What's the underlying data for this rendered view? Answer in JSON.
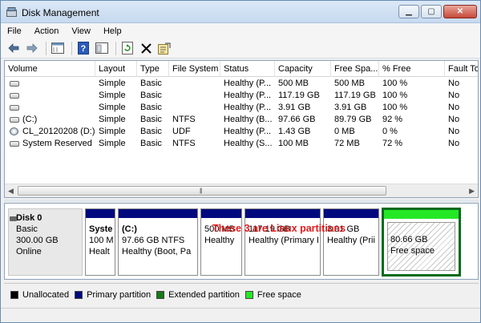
{
  "window": {
    "title": "Disk Management"
  },
  "menu": [
    "File",
    "Action",
    "View",
    "Help"
  ],
  "toolbar": {
    "icons": [
      "back-arrow-icon",
      "forward-arrow-icon",
      "properties-icon",
      "help-icon",
      "show-hide-icon",
      "refresh-icon",
      "delete-icon",
      "properties-wizard-icon"
    ]
  },
  "columns": [
    "Volume",
    "Layout",
    "Type",
    "File System",
    "Status",
    "Capacity",
    "Free Spa...",
    "% Free",
    "Fault To"
  ],
  "volumes": [
    {
      "icon": "drive-icon",
      "name": "",
      "layout": "Simple",
      "type": "Basic",
      "fs": "",
      "status": "Healthy (P...",
      "capacity": "500 MB",
      "free": "500 MB",
      "pct": "100 %",
      "fault": "No"
    },
    {
      "icon": "drive-icon",
      "name": "",
      "layout": "Simple",
      "type": "Basic",
      "fs": "",
      "status": "Healthy (P...",
      "capacity": "117.19 GB",
      "free": "117.19 GB",
      "pct": "100 %",
      "fault": "No"
    },
    {
      "icon": "drive-icon",
      "name": "",
      "layout": "Simple",
      "type": "Basic",
      "fs": "",
      "status": "Healthy (P...",
      "capacity": "3.91 GB",
      "free": "3.91 GB",
      "pct": "100 %",
      "fault": "No"
    },
    {
      "icon": "drive-icon",
      "name": "(C:)",
      "layout": "Simple",
      "type": "Basic",
      "fs": "NTFS",
      "status": "Healthy (B...",
      "capacity": "97.66 GB",
      "free": "89.79 GB",
      "pct": "92 %",
      "fault": "No"
    },
    {
      "icon": "cd-icon",
      "name": "CL_20120208 (D:)",
      "layout": "Simple",
      "type": "Basic",
      "fs": "UDF",
      "status": "Healthy (P...",
      "capacity": "1.43 GB",
      "free": "0 MB",
      "pct": "0 %",
      "fault": "No"
    },
    {
      "icon": "drive-icon",
      "name": "System Reserved",
      "layout": "Simple",
      "type": "Basic",
      "fs": "NTFS",
      "status": "Healthy (S...",
      "capacity": "100 MB",
      "free": "72 MB",
      "pct": "72 %",
      "fault": "No"
    }
  ],
  "disk": {
    "name": "Disk 0",
    "type": "Basic",
    "size": "300.00 GB",
    "state": "Online"
  },
  "partitions": [
    {
      "title": "Syste",
      "size": "100 M",
      "status": "Healt"
    },
    {
      "title": "(C:)",
      "size": "97.66 GB NTFS",
      "status": "Healthy (Boot, Pa"
    },
    {
      "title": "",
      "size": "500 MB",
      "status": "Healthy"
    },
    {
      "title": "",
      "size": "117.19 GB",
      "status": "Healthy (Primary P"
    },
    {
      "title": "",
      "size": "3.91 GB",
      "status": "Healthy (Prii"
    }
  ],
  "free_partition": {
    "size": "80.66 GB",
    "label": "Free space"
  },
  "annotation": "These 3 are Linux partitions",
  "legend": [
    {
      "label": "Unallocated",
      "color": "#000000"
    },
    {
      "label": "Primary partition",
      "color": "#000a7e"
    },
    {
      "label": "Extended partition",
      "color": "#157a15"
    },
    {
      "label": "Free space",
      "color": "#25e825"
    }
  ]
}
